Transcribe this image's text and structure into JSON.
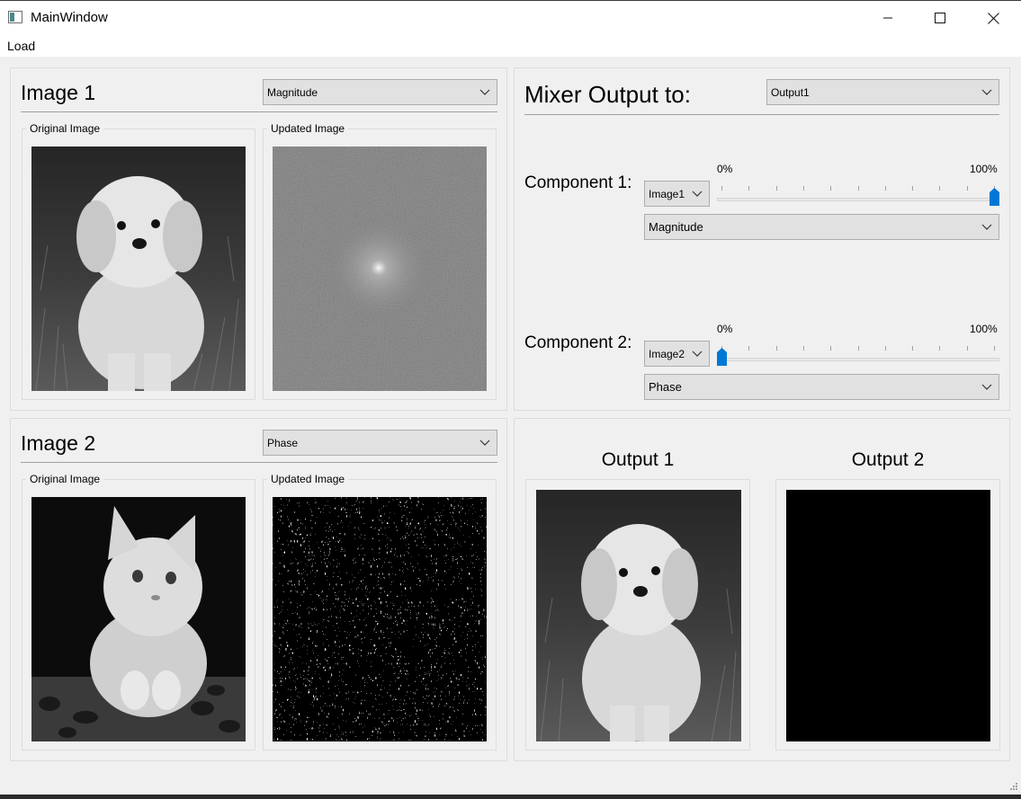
{
  "window": {
    "title": "MainWindow",
    "minimize_glyph": "—",
    "maximize_glyph": "☐",
    "close_glyph": "✕"
  },
  "menu": {
    "load_label": "Load"
  },
  "image1": {
    "title": "Image 1",
    "mode_selected": "Magnitude",
    "original_label": "Original Image",
    "updated_label": "Updated Image"
  },
  "image2": {
    "title": "Image 2",
    "mode_selected": "Phase",
    "original_label": "Original Image",
    "updated_label": "Updated Image"
  },
  "mixer": {
    "title": "Mixer Output to:",
    "output_selected": "Output1",
    "component1": {
      "label": "Component 1:",
      "image_selected": "Image1",
      "mode_selected": "Magnitude",
      "min_label": "0%",
      "max_label": "100%",
      "value_percent": 100
    },
    "component2": {
      "label": "Component 2:",
      "image_selected": "Image2",
      "mode_selected": "Phase",
      "min_label": "0%",
      "max_label": "100%",
      "value_percent": 0
    }
  },
  "outputs": {
    "output1_title": "Output 1",
    "output2_title": "Output 2"
  },
  "colors": {
    "slider_accent": "#0078d7",
    "window_bg": "#f0f0f0",
    "combo_bg": "#e1e1e1"
  }
}
